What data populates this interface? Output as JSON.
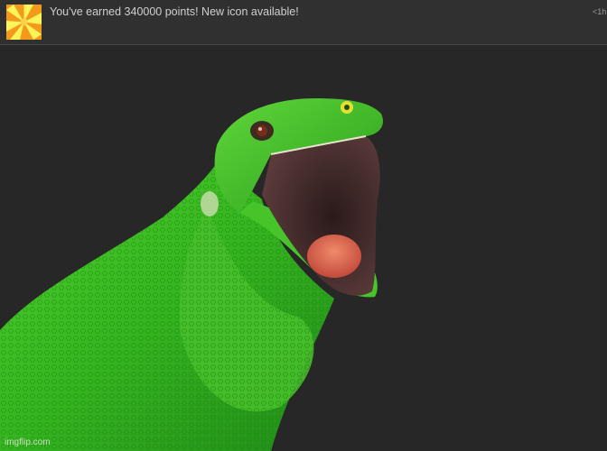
{
  "notification": {
    "icon": "sunburst-icon",
    "message": "You've earned 340000 points! New icon available!",
    "time": "<1h"
  },
  "image": {
    "subject": "lizard-icon",
    "watermark": "imgflip.com"
  },
  "colors": {
    "background": "#272727",
    "notification_bar": "#303030",
    "icon_orange": "#f39a1c",
    "icon_yellow": "#fff35a",
    "lizard_green": "#3bbf22"
  }
}
